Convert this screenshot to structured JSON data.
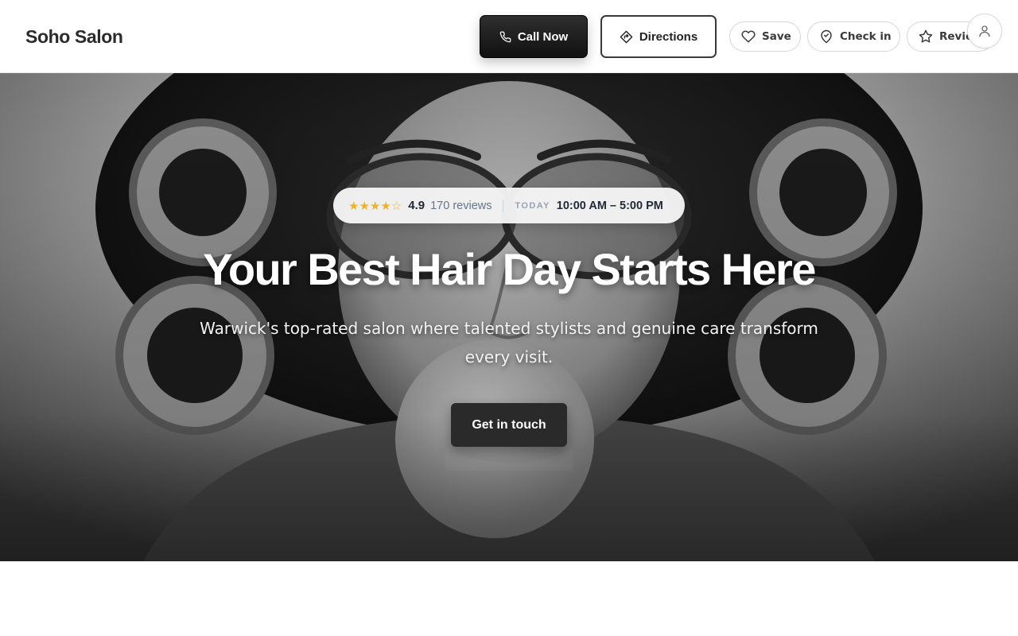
{
  "header": {
    "brand": "Soho Salon",
    "call_label": "Call Now",
    "directions_label": "Directions",
    "save_label": "Save",
    "checkin_label": "Check in",
    "review_label": "Review"
  },
  "icons": {
    "call": "phone-icon",
    "directions": "directions-icon",
    "save": "heart-icon",
    "checkin": "map-pin-icon",
    "review": "star-icon",
    "account": "user-icon"
  },
  "hero": {
    "stars": "★★★★",
    "half_star": "☆",
    "rating": "4.9",
    "review_count": "170 reviews",
    "today_label": "TODAY",
    "hours": "10:00 AM – 5:00 PM",
    "title": "Your Best Hair Day Starts Here",
    "subtitle": "Warwick's top-rated salon where talented stylists and genuine care transform every visit.",
    "cta_label": "Get in touch"
  },
  "colors": {
    "primary_button": "#1a1a1a",
    "star": "#f0b323",
    "muted_text": "#64748b",
    "white": "#ffffff"
  }
}
